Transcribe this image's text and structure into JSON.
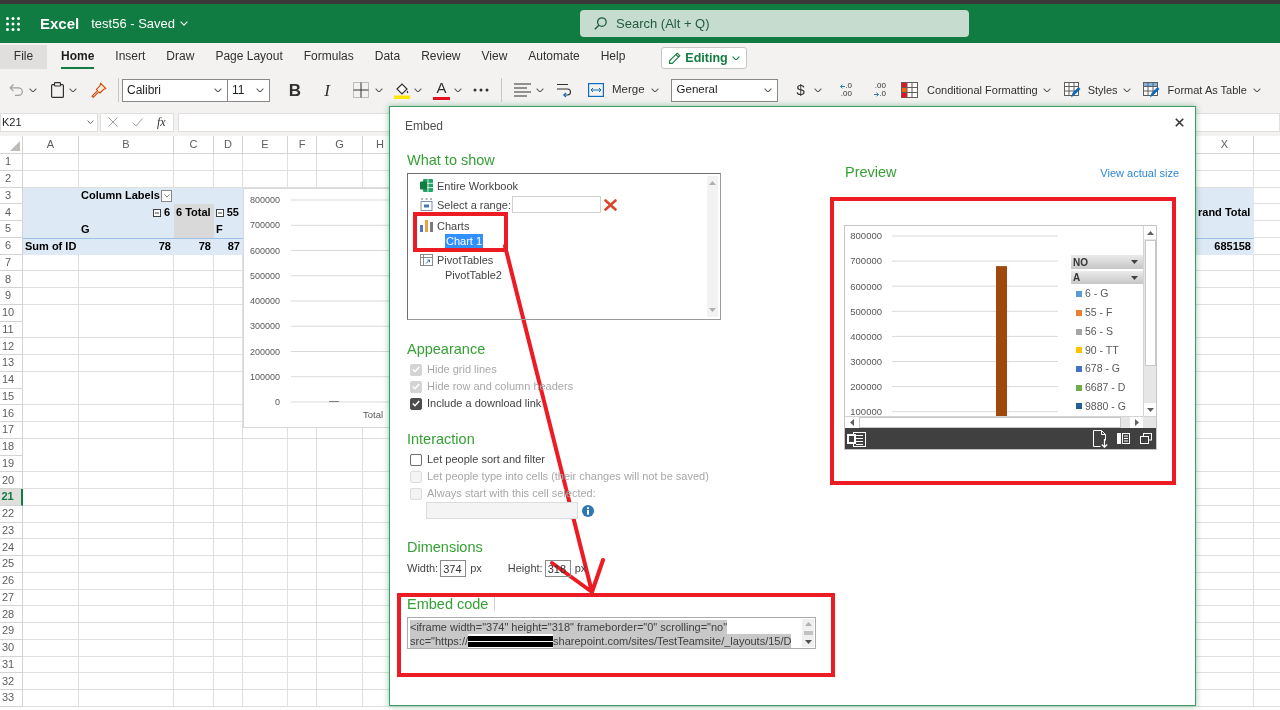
{
  "app_bar": {
    "app_name": "Excel",
    "document_title": "test56 - Saved",
    "search": {
      "placeholder": "Search (Alt + Q)"
    }
  },
  "ribbon_tabs": [
    {
      "label": "File",
      "kind": "menu",
      "selected": false
    },
    {
      "label": "Home",
      "kind": "tab",
      "selected": true
    },
    {
      "label": "Insert",
      "kind": "tab",
      "selected": false
    },
    {
      "label": "Draw",
      "kind": "tab",
      "selected": false
    },
    {
      "label": "Page Layout",
      "kind": "tab",
      "selected": false
    },
    {
      "label": "Formulas",
      "kind": "tab",
      "selected": false
    },
    {
      "label": "Data",
      "kind": "tab",
      "selected": false
    },
    {
      "label": "Review",
      "kind": "tab",
      "selected": false
    },
    {
      "label": "View",
      "kind": "tab",
      "selected": false
    },
    {
      "label": "Automate",
      "kind": "tab",
      "selected": false
    },
    {
      "label": "Help",
      "kind": "tab",
      "selected": false
    }
  ],
  "mode_button": {
    "label": "Editing"
  },
  "toolbar": {
    "font": "Calibri",
    "font_size": "11",
    "bold": "B",
    "italic": "I",
    "font_color": "A",
    "merge": "Merge",
    "number_format": "General",
    "currency": "$",
    "increase_decimal": [
      ".0",
      ".00"
    ],
    "decrease_decimal": [
      ".00",
      ".0"
    ],
    "conditional_formatting": "Conditional Formatting",
    "styles": "Styles",
    "format_as_table": "Format As Table"
  },
  "formula_bar": {
    "name_box": "K21",
    "function_label": "fx"
  },
  "sheet": {
    "columns": [
      "A",
      "B",
      "C",
      "D",
      "E",
      "F",
      "G",
      "H"
    ],
    "right_columns": [
      "X"
    ],
    "rows": [
      {
        "label": "1",
        "kind": "plain",
        "selected": false
      },
      {
        "label": "2",
        "kind": "plain",
        "selected": false
      },
      {
        "label": "3",
        "kind": "pivot_header",
        "selected": false,
        "cells": {
          "b": {
            "kind": "filter",
            "text": "Column Labels"
          }
        }
      },
      {
        "label": "4",
        "kind": "pivot_header",
        "selected": false,
        "cells": {
          "b": {
            "kind": "collapse",
            "text": "6"
          },
          "c": {
            "kind": "subtotal",
            "text": "6 Total"
          },
          "d": {
            "kind": "collapse",
            "text": "55"
          },
          "x": {
            "kind": "label",
            "text": "rand Total"
          }
        }
      },
      {
        "label": "5",
        "kind": "pivot_header",
        "selected": false,
        "cells": {
          "b": {
            "kind": "label",
            "text": "G"
          },
          "c": {
            "kind": "subtotal"
          },
          "d": {
            "kind": "label",
            "text": "F"
          }
        }
      },
      {
        "label": "6",
        "kind": "pivot_values",
        "selected": false,
        "cells": {
          "a": {
            "kind": "label",
            "text": "Sum of ID"
          },
          "b": {
            "kind": "number",
            "text": "78"
          },
          "c": {
            "kind": "number",
            "text": "78"
          },
          "d": {
            "kind": "number",
            "text": "87"
          },
          "x": {
            "kind": "number",
            "text": "685158"
          }
        }
      },
      {
        "label": "7",
        "kind": "plain",
        "selected": false
      },
      {
        "label": "8",
        "kind": "plain",
        "selected": false
      },
      {
        "label": "9",
        "kind": "plain",
        "selected": false
      },
      {
        "label": "10",
        "kind": "plain",
        "selected": false
      },
      {
        "label": "11",
        "kind": "plain",
        "selected": false
      },
      {
        "label": "12",
        "kind": "plain",
        "selected": false
      },
      {
        "label": "13",
        "kind": "plain",
        "selected": false
      },
      {
        "label": "14",
        "kind": "plain",
        "selected": false
      },
      {
        "label": "15",
        "kind": "plain",
        "selected": false
      },
      {
        "label": "16",
        "kind": "plain",
        "selected": false
      },
      {
        "label": "17",
        "kind": "plain",
        "selected": false
      },
      {
        "label": "18",
        "kind": "plain",
        "selected": false
      },
      {
        "label": "19",
        "kind": "plain",
        "selected": false
      },
      {
        "label": "20",
        "kind": "plain",
        "selected": false
      },
      {
        "label": "21",
        "kind": "plain",
        "selected": true
      },
      {
        "label": "22",
        "kind": "plain",
        "selected": false
      },
      {
        "label": "23",
        "kind": "plain",
        "selected": false
      },
      {
        "label": "24",
        "kind": "plain",
        "selected": false
      },
      {
        "label": "25",
        "kind": "plain",
        "selected": false
      },
      {
        "label": "26",
        "kind": "plain",
        "selected": false
      },
      {
        "label": "27",
        "kind": "plain",
        "selected": false
      },
      {
        "label": "28",
        "kind": "plain",
        "selected": false
      },
      {
        "label": "29",
        "kind": "plain",
        "selected": false
      },
      {
        "label": "30",
        "kind": "plain",
        "selected": false
      },
      {
        "label": "31",
        "kind": "plain",
        "selected": false
      },
      {
        "label": "32",
        "kind": "plain",
        "selected": false
      },
      {
        "label": "33",
        "kind": "plain",
        "selected": false
      }
    ],
    "chart": {
      "chart_data": {
        "type": "bar",
        "grid": true,
        "categories": [
          "Total"
        ],
        "values": [
          0
        ],
        "ylim": [
          0,
          800000
        ],
        "yticks": [
          0,
          100000,
          200000,
          300000,
          400000,
          500000,
          600000,
          700000,
          800000
        ]
      }
    }
  },
  "dialog": {
    "title": "Embed",
    "what_to_show": {
      "heading": "What to show",
      "items": [
        {
          "label": "Entire Workbook",
          "kind": "workbook",
          "selected": false,
          "highlighted": false
        },
        {
          "label": "Select a range:",
          "kind": "range",
          "selected": false,
          "highlighted": false
        },
        {
          "label": "Charts",
          "kind": "charts",
          "selected": false,
          "highlighted": true,
          "children": [
            {
              "label": "Chart 1",
              "selected": true
            }
          ]
        },
        {
          "label": "PivotTables",
          "kind": "pivots",
          "selected": false,
          "highlighted": false,
          "children": [
            {
              "label": "PivotTable2",
              "selected": false
            }
          ]
        }
      ]
    },
    "appearance": {
      "heading": "Appearance",
      "options": [
        {
          "label": "Hide grid lines",
          "checked": true,
          "disabled": true
        },
        {
          "label": "Hide row and column headers",
          "checked": true,
          "disabled": true
        },
        {
          "label": "Include a download link",
          "checked": true,
          "disabled": false
        }
      ]
    },
    "interaction": {
      "heading": "Interaction",
      "options": [
        {
          "label": "Let people sort and filter",
          "checked": false,
          "disabled": false
        },
        {
          "label": "Let people type into cells (their changes will not be saved)",
          "checked": false,
          "disabled": true
        },
        {
          "label": "Always start with this cell selected:",
          "checked": false,
          "disabled": true
        }
      ],
      "start_cell": {
        "disabled": true
      }
    },
    "dimensions": {
      "heading": "Dimensions",
      "fields": [
        {
          "label": "Width:",
          "value": "374",
          "unit": "px"
        },
        {
          "label": "Height:",
          "value": "318",
          "unit": "px"
        }
      ]
    },
    "embed_code": {
      "heading": "Embed code",
      "highlighted": true,
      "pointed_to": true,
      "lines": [
        {
          "text": "<iframe width=\"374\" height=\"318\" frameborder=\"0\" scrolling=\"no\""
        },
        {
          "text": "src=\"https://",
          "redacted": true,
          "rest": "sharepoint.com/sites/TestTeamsite/_layouts/15/D"
        }
      ]
    },
    "preview": {
      "heading": "Preview",
      "link": "View actual size",
      "highlighted": true,
      "chart_data": {
        "type": "bar",
        "grid": true,
        "series": [
          {
            "color": "#9e480e",
            "values": [
              680000
            ]
          }
        ],
        "ylim": [
          100000,
          800000
        ],
        "yticks": [
          100000,
          200000,
          300000,
          400000,
          500000,
          600000,
          700000,
          800000
        ]
      },
      "legend": {
        "filters": [
          {
            "label": "NO"
          },
          {
            "label": "A"
          }
        ],
        "items": [
          {
            "label": "6 - G",
            "color": "#5b9bd5"
          },
          {
            "label": "55 - F",
            "color": "#ed7d31"
          },
          {
            "label": "56 - S",
            "color": "#a5a5a5"
          },
          {
            "label": "90 - TT",
            "color": "#ffc000"
          },
          {
            "label": "678 - G",
            "color": "#4472c4"
          },
          {
            "label": "6687 - D",
            "color": "#70ad47"
          },
          {
            "label": "9880 - G",
            "color": "#255e91"
          }
        ]
      }
    }
  }
}
